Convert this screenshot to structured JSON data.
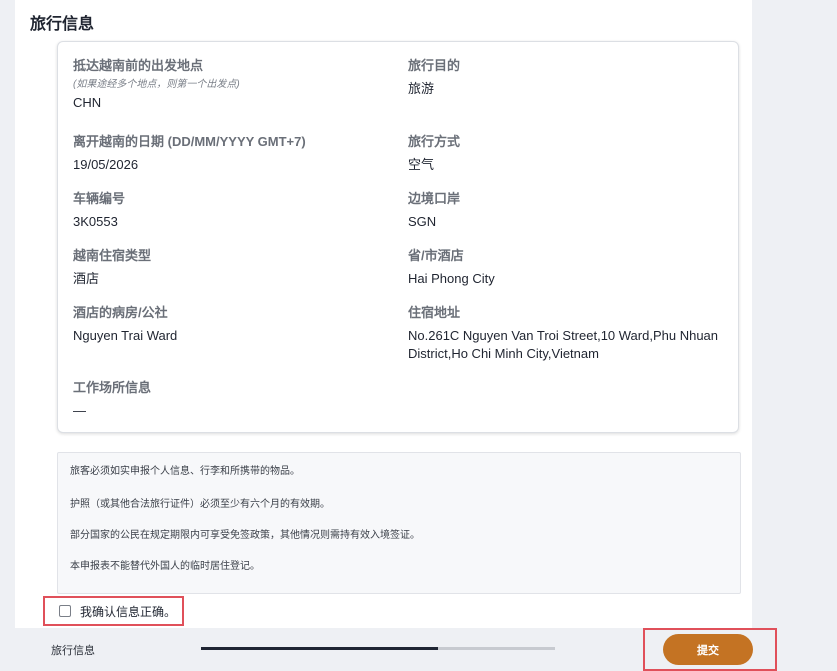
{
  "section": {
    "title": "旅行信息"
  },
  "fields": {
    "departure_point": {
      "label": "抵达越南前的出发地点",
      "hint": "(如果途经多个地点，则第一个出发点)",
      "value": "CHN"
    },
    "travel_purpose": {
      "label": "旅行目的",
      "value": "旅游"
    },
    "departure_date": {
      "label": "离开越南的日期 (DD/MM/YYYY GMT+7)",
      "value": "19/05/2026"
    },
    "travel_mode": {
      "label": "旅行方式",
      "value": "空气"
    },
    "vehicle_number": {
      "label": "车辆编号",
      "value": "3K0553"
    },
    "border_gate": {
      "label": "边境口岸",
      "value": "SGN"
    },
    "accommodation_type": {
      "label": "越南住宿类型",
      "value": "酒店"
    },
    "province_hotel": {
      "label": "省/市酒店",
      "value": "Hai Phong City"
    },
    "hotel_ward": {
      "label": "酒店的病房/公社",
      "value": "Nguyen Trai Ward"
    },
    "accommodation_address": {
      "label": "住宿地址",
      "value": "No.261C Nguyen Van Troi Street,10 Ward,Phu Nhuan District,Ho Chi Minh City,Vietnam"
    },
    "workplace_info": {
      "label": "工作场所信息",
      "value": "—"
    }
  },
  "notice": {
    "lines": [
      "旅客必须如实申报个人信息、行李和所携带的物品。",
      "护照（或其他合法旅行证件）必须至少有六个月的有效期。",
      "部分国家的公民在规定期限内可享受免签政策，其他情况则需持有效入境签证。",
      "本申报表不能替代外国人的临时居住登记。"
    ]
  },
  "confirm": {
    "label": "我确认信息正确。",
    "checked": false
  },
  "footer": {
    "step_label": "旅行信息",
    "progress": 0.67,
    "submit_label": "提交"
  },
  "colors": {
    "accent": "#c47323",
    "highlight": "#e0505a",
    "progress_fill": "#1f2533"
  }
}
